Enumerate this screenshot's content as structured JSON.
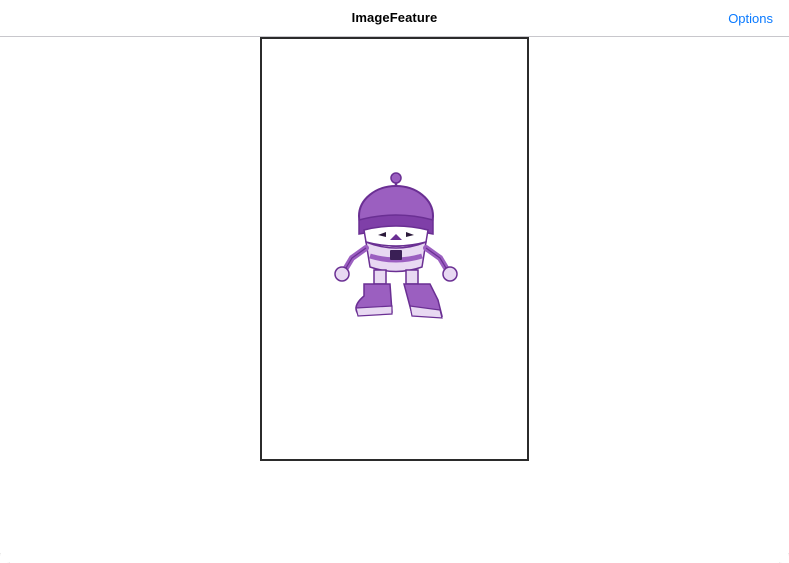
{
  "navbar": {
    "title": "ImageFeature",
    "options_label": "Options"
  },
  "image": {
    "icon": "robot-mascot-icon",
    "colors": {
      "primary": "#9b5fc0",
      "dark": "#6a2f93",
      "light": "#e8d9f2",
      "frame": "#2b2b2b",
      "accent": "#0a7aff"
    }
  }
}
